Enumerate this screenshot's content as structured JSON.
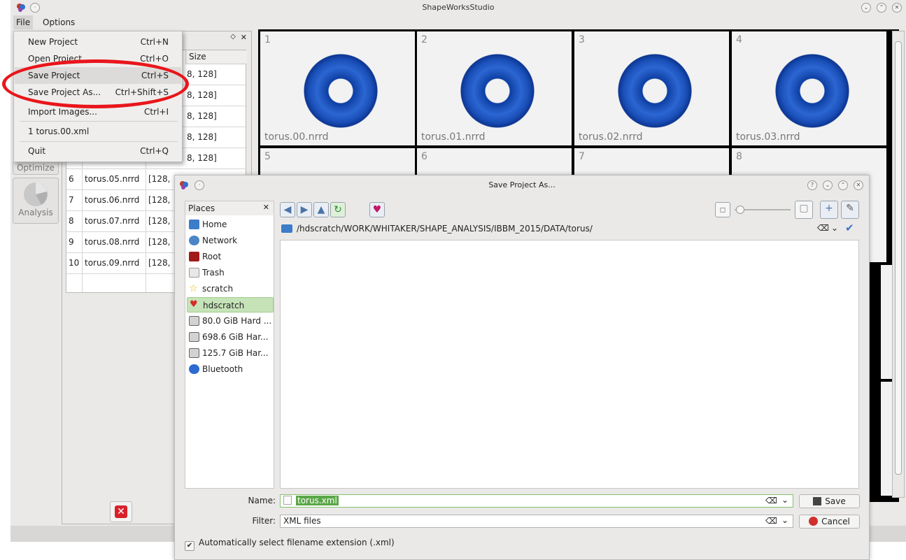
{
  "window": {
    "title": "ShapeWorksStudio"
  },
  "menubar": {
    "file": "File",
    "options": "Options"
  },
  "file_menu": [
    {
      "label": "New Project",
      "shortcut": "Ctrl+N"
    },
    {
      "label": "Open Project",
      "shortcut": "Ctrl+O"
    },
    {
      "label": "Save Project",
      "shortcut": "Ctrl+S"
    },
    {
      "label": "Save Project As...",
      "shortcut": "Ctrl+Shift+S"
    },
    {
      "label": "Import Images...",
      "shortcut": "Ctrl+I"
    },
    {
      "label": "1 torus.00.xml",
      "shortcut": ""
    },
    {
      "label": "Quit",
      "shortcut": "Ctrl+Q"
    }
  ],
  "tools": {
    "optimize": "Optimize",
    "analysis": "Analysis"
  },
  "table": {
    "size_header": "Size",
    "top_rows_size": [
      "8, 128]",
      "8, 128]",
      "8, 128]",
      "8, 128]",
      "8, 128]"
    ],
    "rows": [
      {
        "num": "6",
        "name": "torus.05.nrrd",
        "size": "[128,"
      },
      {
        "num": "7",
        "name": "torus.06.nrrd",
        "size": "[128,"
      },
      {
        "num": "8",
        "name": "torus.07.nrrd",
        "size": "[128,"
      },
      {
        "num": "9",
        "name": "torus.08.nrrd",
        "size": "[128,"
      },
      {
        "num": "10",
        "name": "torus.09.nrrd",
        "size": "[128,"
      }
    ]
  },
  "viewer": {
    "cells": [
      {
        "index": "1",
        "label": "torus.00.nrrd"
      },
      {
        "index": "2",
        "label": "torus.01.nrrd"
      },
      {
        "index": "3",
        "label": "torus.02.nrrd"
      },
      {
        "index": "4",
        "label": "torus.03.nrrd"
      },
      {
        "index": "5",
        "label": ""
      },
      {
        "index": "6",
        "label": ""
      },
      {
        "index": "7",
        "label": ""
      },
      {
        "index": "8",
        "label": ""
      }
    ],
    "torus_color": "#1a4fb8"
  },
  "dialog": {
    "title": "Save Project As...",
    "places_header": "Places",
    "places": [
      "Home",
      "Network",
      "Root",
      "Trash",
      "scratch",
      "hdscratch",
      "80.0 GiB Hard ...",
      "698.6 GiB Har...",
      "125.7 GiB Har...",
      "Bluetooth"
    ],
    "path": "/hdscratch/WORK/WHITAKER/SHAPE_ANALYSIS/IBBM_2015/DATA/torus/",
    "name_label": "Name:",
    "name_value": "torus.xml",
    "filter_label": "Filter:",
    "filter_value": "XML files",
    "save_button": "Save",
    "cancel_button": "Cancel",
    "auto_extension": "Automatically select filename extension (.xml)"
  },
  "colors": {
    "highlight_ring": "#e8161b",
    "selection_green": "#5aa747"
  }
}
